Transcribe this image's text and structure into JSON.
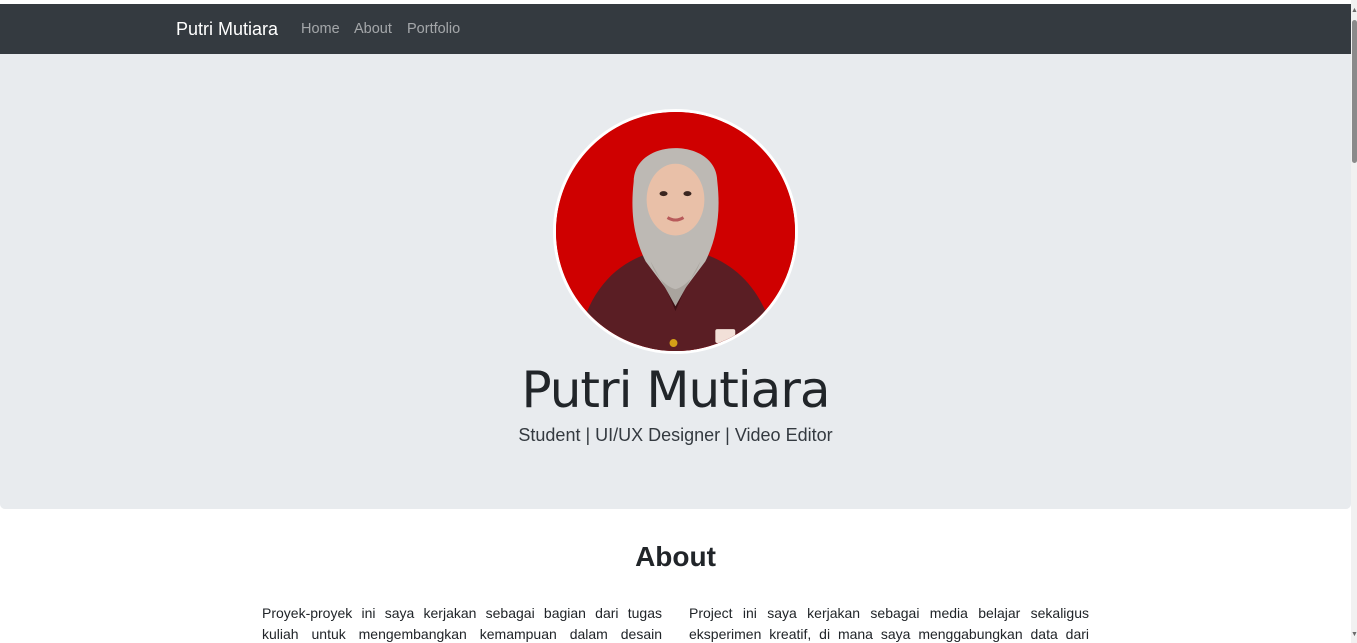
{
  "navbar": {
    "brand": "Putri Mutiara",
    "links": [
      "Home",
      "About",
      "Portfolio"
    ]
  },
  "hero": {
    "name": "Putri Mutiara",
    "subtitle": "Student | UI/UX Designer | Video Editor",
    "avatar_icon": "profile-photo"
  },
  "about": {
    "title": "About",
    "left_text": "Proyek-proyek ini saya kerjakan sebagai bagian dari tugas kuliah untuk mengembangkan kemampuan dalam desain",
    "right_text": "Project ini saya kerjakan sebagai media belajar sekaligus eksperimen kreatif, di mana saya menggabungkan data dari"
  },
  "colors": {
    "navbar": "#343a40",
    "hero_bg": "#e8ebee",
    "avatar_bg": "#cf0000"
  }
}
